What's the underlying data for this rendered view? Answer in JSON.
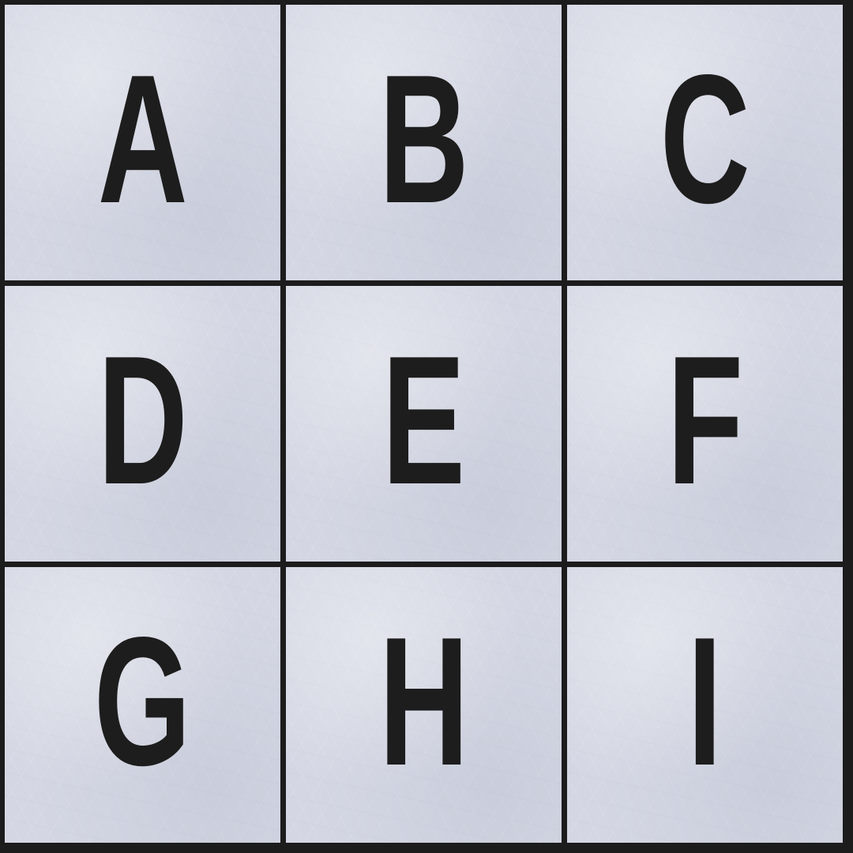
{
  "tiles": [
    {
      "letter": "A"
    },
    {
      "letter": "B"
    },
    {
      "letter": "C"
    },
    {
      "letter": "D"
    },
    {
      "letter": "E"
    },
    {
      "letter": "F"
    },
    {
      "letter": "G"
    },
    {
      "letter": "H"
    },
    {
      "letter": "I"
    }
  ],
  "colors": {
    "grid_line": "#1c1c1c",
    "tile_background": "#d4d7e3",
    "letter": "#1d1d1d"
  }
}
